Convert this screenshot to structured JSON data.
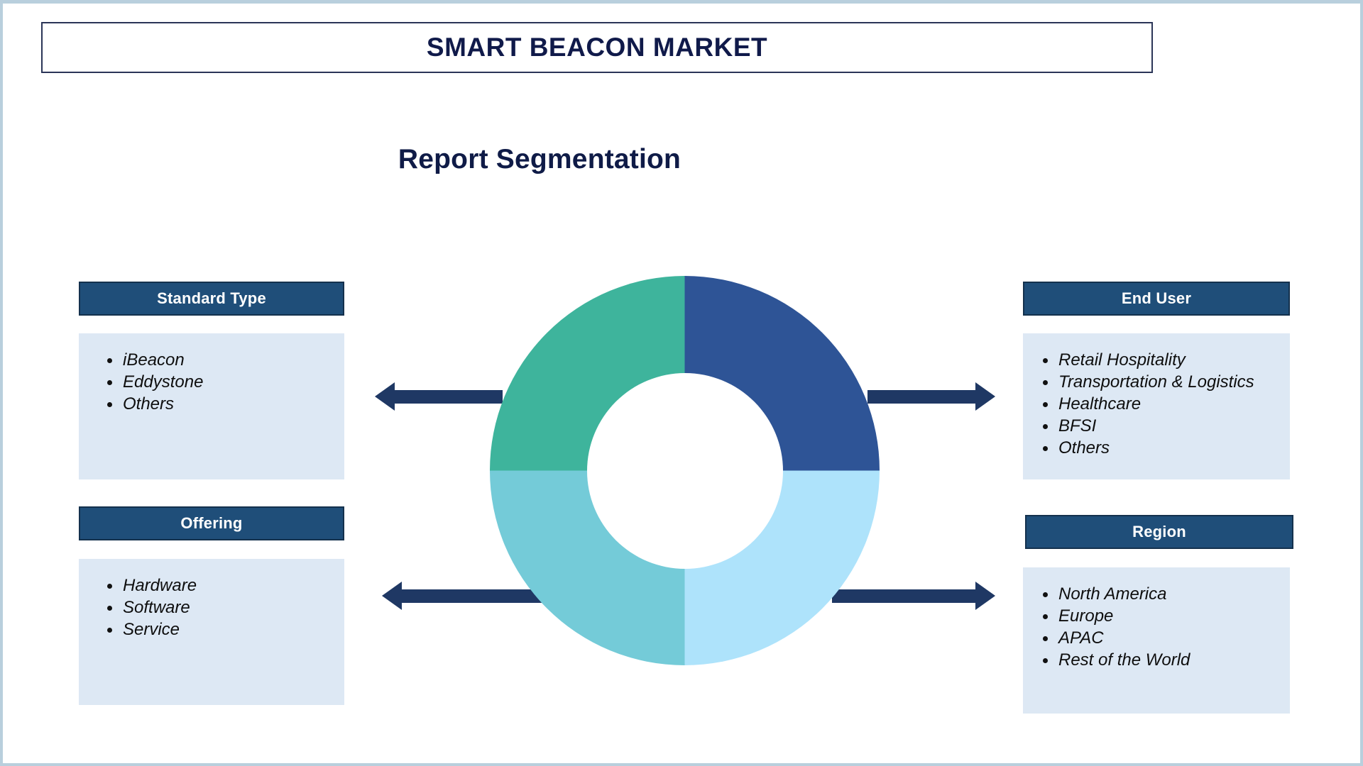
{
  "title": "SMART BEACON MARKET",
  "heading": "Report Segmentation",
  "colors": {
    "header_blue": "#1f4e79",
    "body_light_blue": "#dde8f4",
    "arrow_navy": "#1f3864",
    "title_navy": "#101a4a",
    "page_border": "#b9cfdd",
    "donut_top_left_teal": "#3eb49c",
    "donut_top_right_blue": "#2e5496",
    "donut_bottom_left_teal": "#74cbd8",
    "donut_bottom_right_blue": "#aee3fb"
  },
  "segments": {
    "standard_type": {
      "header": "Standard Type",
      "items": [
        "iBeacon",
        "Eddystone",
        "Others"
      ]
    },
    "offering": {
      "header": "Offering",
      "items": [
        "Hardware",
        "Software",
        "Service"
      ]
    },
    "end_user": {
      "header": "End User",
      "items": [
        "Retail Hospitality",
        "Transportation & Logistics",
        "Healthcare",
        "BFSI",
        "Others"
      ]
    },
    "region": {
      "header": "Region",
      "items": [
        "North America",
        "Europe",
        "APAC",
        "Rest of the World"
      ]
    }
  },
  "chart_data": {
    "type": "pie",
    "title": "Report Segmentation",
    "variant": "donut",
    "hole_ratio": 0.5,
    "categories": [
      "Standard Type",
      "End User",
      "Offering",
      "Region"
    ],
    "values": [
      25,
      25,
      25,
      25
    ],
    "slice_colors": [
      "#3eb49c",
      "#2e5496",
      "#74cbd8",
      "#aee3fb"
    ],
    "slice_positions": [
      "top-left",
      "top-right",
      "bottom-left",
      "bottom-right"
    ],
    "legend": "none",
    "labels_shown": false
  },
  "arrows": [
    {
      "name": "arrow-left-top",
      "direction": "left",
      "connects": "Standard Type"
    },
    {
      "name": "arrow-left-bottom",
      "direction": "left",
      "connects": "Offering"
    },
    {
      "name": "arrow-right-top",
      "direction": "right",
      "connects": "End User"
    },
    {
      "name": "arrow-right-bottom",
      "direction": "right",
      "connects": "Region"
    }
  ]
}
